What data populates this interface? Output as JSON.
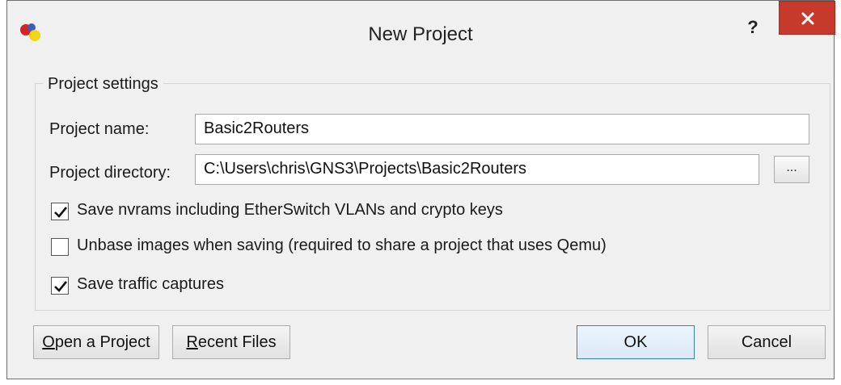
{
  "window": {
    "title": "New Project",
    "help_label": "?",
    "close_icon": "close-icon",
    "app_icon": "gns3-app-icon"
  },
  "group": {
    "title": "Project settings"
  },
  "fields": {
    "project_name_label": "Project name:",
    "project_name_value": "Basic2Routers",
    "project_directory_label": "Project directory:",
    "project_directory_value": "C:\\Users\\chris\\GNS3\\Projects\\Basic2Routers",
    "browse_label": "..."
  },
  "options": [
    {
      "label": "Save nvrams including EtherSwitch VLANs and crypto keys",
      "checked": true
    },
    {
      "label": "Unbase images when saving (required to share a project that uses Qemu)",
      "checked": false
    },
    {
      "label": "Save traffic captures",
      "checked": true
    }
  ],
  "buttons": {
    "open_project": {
      "mnemonic": "O",
      "rest": "pen a Project"
    },
    "recent_files": {
      "mnemonic": "R",
      "rest": "ecent Files"
    },
    "ok": "OK",
    "cancel": "Cancel"
  },
  "colors": {
    "close_button": "#c7392b",
    "default_button_border": "#3c7fb1"
  }
}
